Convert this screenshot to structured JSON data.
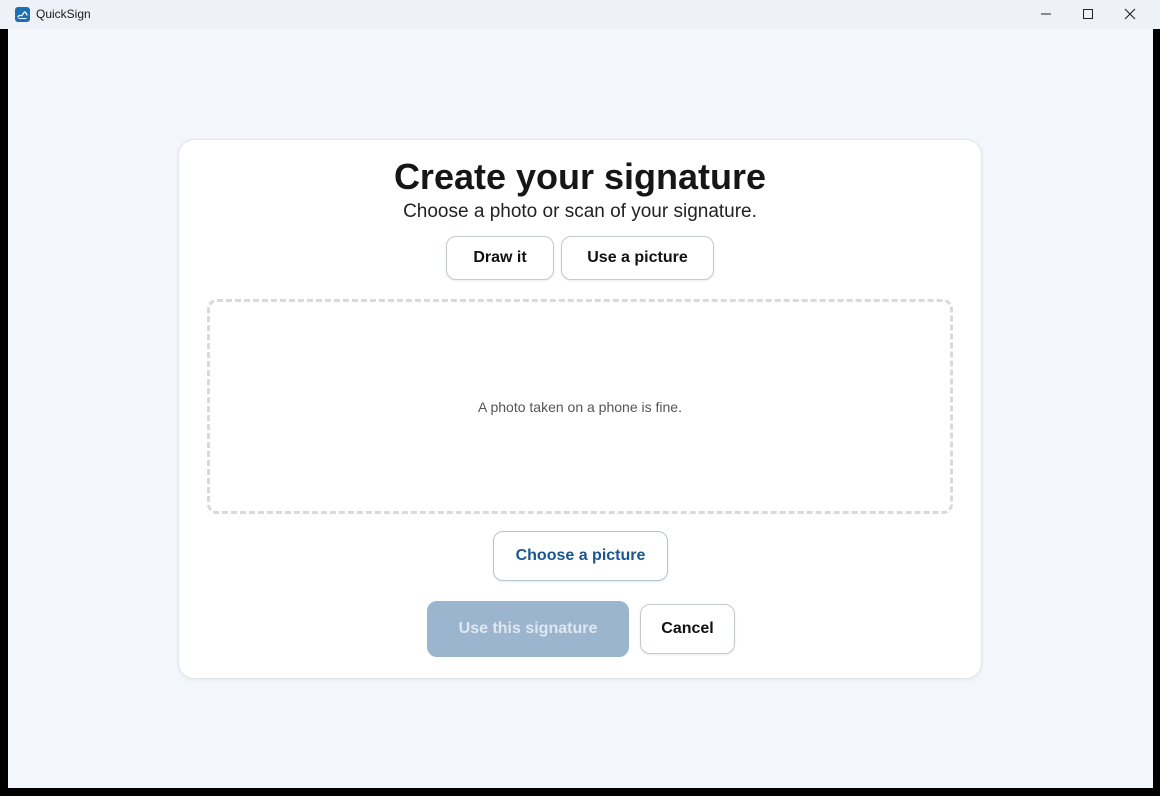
{
  "window": {
    "title": "QuickSign",
    "icon": "quicksign-app-icon",
    "controls": [
      "minimize-icon",
      "maximize-icon",
      "close-icon"
    ]
  },
  "dialog": {
    "title": "Create your signature",
    "subtitle": "Choose a photo or scan of your signature.",
    "mode_tabs": [
      {
        "label": "Draw it"
      },
      {
        "label": "Use a picture"
      }
    ],
    "dropzone_hint": "A photo taken on a phone is fine.",
    "choose_label": "Choose a picture",
    "use_label": "Use this signature",
    "use_enabled": false,
    "cancel_label": "Cancel"
  },
  "colors": {
    "accent": "#1a5690",
    "disabled_primary": "#9bb5cf",
    "background": "#f3f6fa",
    "card": "#ffffff"
  }
}
